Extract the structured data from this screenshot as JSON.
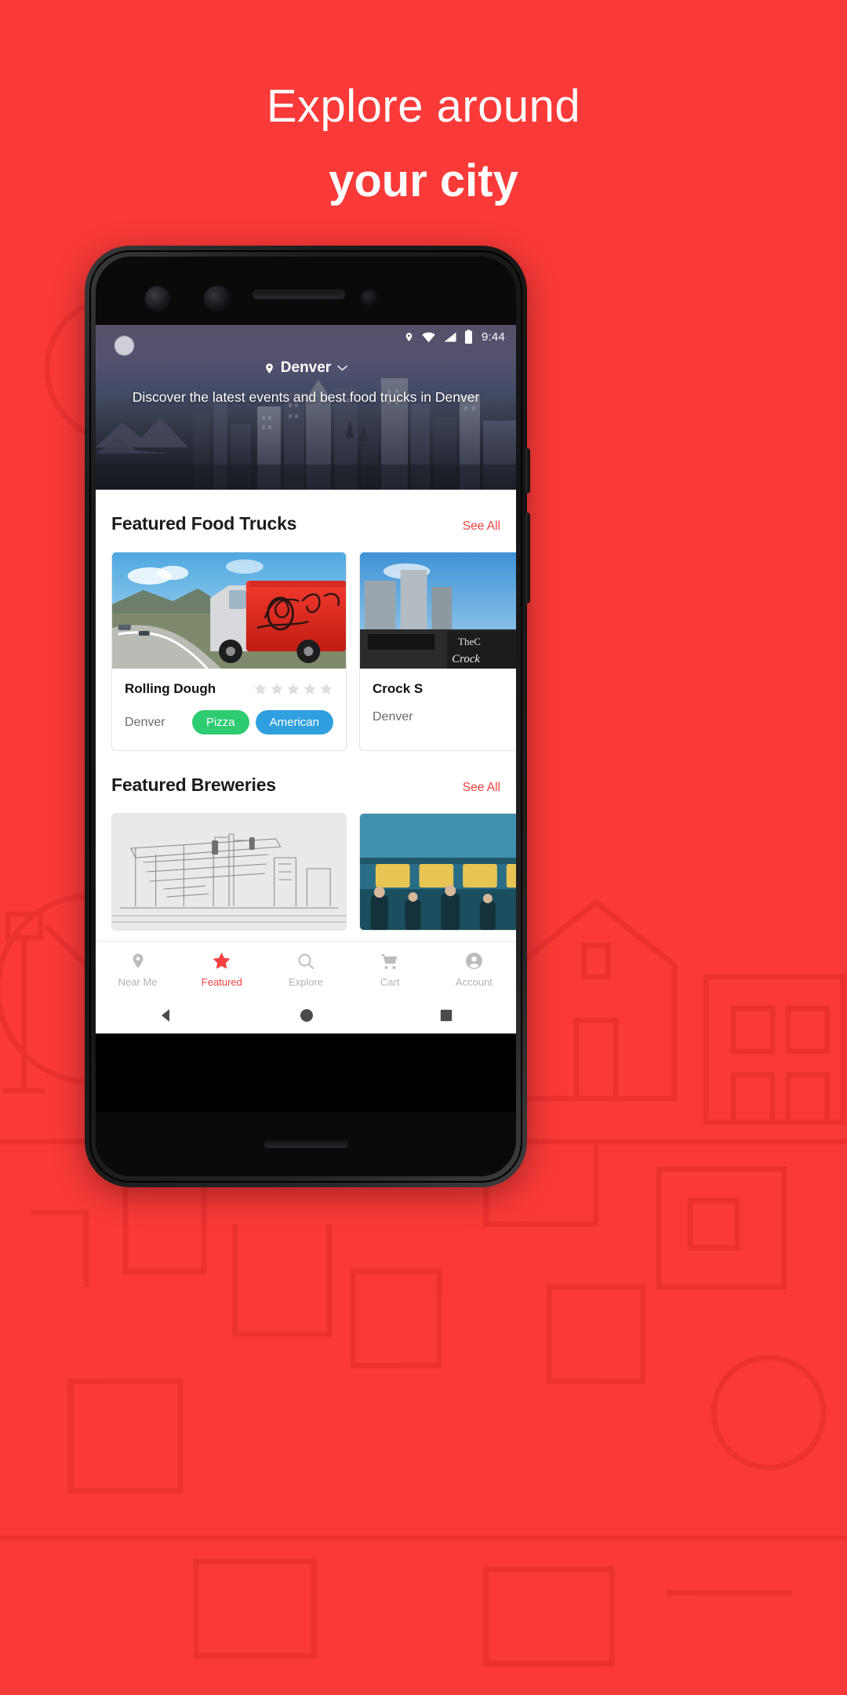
{
  "theme": {
    "brand_red": "#f93a38",
    "accent_red": "#f4413f",
    "tag_green": "#2ecb71",
    "tag_blue": "#2f9fe0"
  },
  "headline": {
    "line1": "Explore around",
    "line2": "your city"
  },
  "phone": {
    "statusbar": {
      "time": "9:44",
      "icons": [
        "location-icon",
        "wifi-icon",
        "signal-icon",
        "battery-icon"
      ]
    },
    "hero": {
      "city": "Denver",
      "city_pin_icon": "location-pin-icon",
      "city_dropdown_icon": "chevron-down-icon",
      "subtitle": "Discover the latest events and best food trucks in Denver"
    },
    "sections": [
      {
        "title": "Featured Food Trucks",
        "see_all": "See All",
        "cards": [
          {
            "name": "Rolling Dough",
            "city": "Denver",
            "rating": 0,
            "stars_total": 5,
            "tags": [
              {
                "label": "Pizza",
                "color": "green"
              },
              {
                "label": "American",
                "color": "blue"
              }
            ]
          },
          {
            "name": "Crock S",
            "city": "Denver",
            "rating": 0,
            "stars_total": 5,
            "tags": []
          }
        ]
      },
      {
        "title": "Featured Breweries",
        "see_all": "See All",
        "cards": [
          {
            "name": "",
            "city": "",
            "rating": 0,
            "stars_total": 5,
            "tags": []
          },
          {
            "name": "",
            "city": "",
            "rating": 0,
            "stars_total": 5,
            "tags": []
          }
        ]
      }
    ],
    "bottom_nav": [
      {
        "label": "Near Me",
        "icon": "location-pin-icon",
        "active": false
      },
      {
        "label": "Featured",
        "icon": "star-icon",
        "active": true
      },
      {
        "label": "Explore",
        "icon": "search-icon",
        "active": false
      },
      {
        "label": "Cart",
        "icon": "shopping-cart-icon",
        "active": false
      },
      {
        "label": "Account",
        "icon": "account-circle-icon",
        "active": false
      }
    ],
    "android_nav": [
      "back-triangle-icon",
      "home-circle-icon",
      "recents-square-icon"
    ]
  }
}
